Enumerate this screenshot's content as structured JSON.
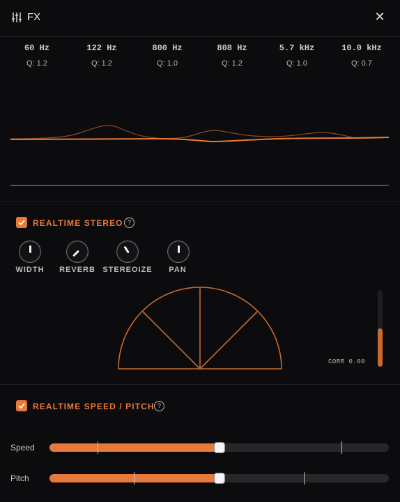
{
  "header": {
    "title": "FX",
    "menu_icon": "sliders-icon",
    "close_icon": "close-icon"
  },
  "eq": {
    "bands": [
      {
        "freq": "60 Hz",
        "q": "Q: 1.2"
      },
      {
        "freq": "122 Hz",
        "q": "Q: 1.2"
      },
      {
        "freq": "800 Hz",
        "q": "Q: 1.0"
      },
      {
        "freq": "808 Hz",
        "q": "Q: 1.2"
      },
      {
        "freq": "5.7 kHz",
        "q": "Q: 1.0"
      },
      {
        "freq": "10.0 kHz",
        "q": "Q: 0.7"
      }
    ]
  },
  "stereo": {
    "enabled": true,
    "label": "REALTIME STEREO",
    "help": "?",
    "knobs": [
      {
        "label": "WIDTH",
        "value": 0.5
      },
      {
        "label": "REVERB",
        "value": 0.0
      },
      {
        "label": "STEREOIZE",
        "value": 0.38
      },
      {
        "label": "PAN",
        "value": 0.5
      }
    ],
    "corr_label": "CORR 0.00",
    "meter_level": 0.5
  },
  "speed_pitch": {
    "enabled": true,
    "label": "REALTIME SPEED / PITCH",
    "help": "?",
    "sliders": [
      {
        "label": "Speed",
        "value": 0.5
      },
      {
        "label": "Pitch",
        "value": 0.5
      }
    ]
  },
  "colors": {
    "accent": "#e8793a",
    "background": "#0c0c0e"
  }
}
